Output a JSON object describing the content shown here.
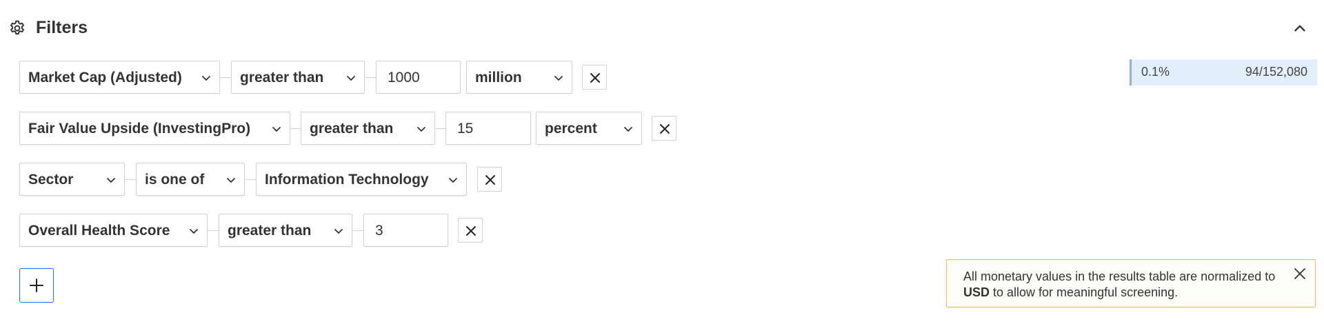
{
  "header": {
    "title": "Filters",
    "icon": "gear-icon",
    "collapse_icon": "chevron-up-icon"
  },
  "filters": [
    {
      "field": "Market Cap (Adjusted)",
      "operator": "greater than",
      "value": "1000",
      "unit": "million"
    },
    {
      "field": "Fair Value Upside (InvestingPro)",
      "operator": "greater than",
      "value": "15",
      "unit": "percent"
    },
    {
      "field": "Sector",
      "operator": "is one of",
      "value": "Information Technology"
    },
    {
      "field": "Overall Health Score",
      "operator": "greater than",
      "value": "3"
    }
  ],
  "add_filter": {
    "label": "+"
  },
  "stats": {
    "percent": "0.1%",
    "count": "94/152,080",
    "fill": 0.001
  },
  "notice": {
    "text_before": "All monetary values in the results table are normalized to ",
    "currency": "USD",
    "text_after": " to allow for meaningful screening."
  },
  "colors": {
    "accent": "#1f6fe0",
    "notice_border": "#f0b860",
    "stats_bg": "#e3effb",
    "border": "#cfd3d8"
  }
}
